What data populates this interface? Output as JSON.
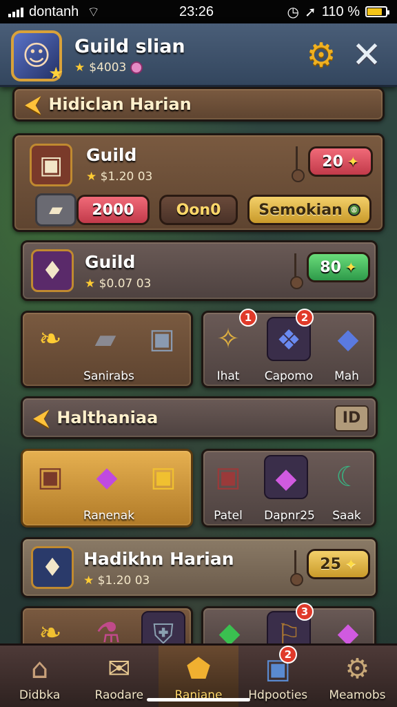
{
  "status_bar": {
    "carrier": "dontanh",
    "time": "23:26",
    "battery": "110 %"
  },
  "header": {
    "title": "Guild slian",
    "currency": "$4003",
    "icons": [
      "avatar",
      "gear-icon",
      "close-icon"
    ]
  },
  "section1": {
    "title": "Hidiclan Harian"
  },
  "guild_card1": {
    "title": "Guild",
    "sub": "$1.20 03",
    "reward": "20",
    "buttons": [
      "2000",
      "Oon0",
      "Semokian"
    ]
  },
  "guild_card2": {
    "title": "Guild",
    "sub": "$0.07 03",
    "reward": "80"
  },
  "row1_left": {
    "label": "Sanirabs"
  },
  "row1_right": {
    "labels": [
      "Ihat",
      "Capomo",
      "Mah"
    ],
    "badges": [
      "1",
      "2"
    ]
  },
  "section2": {
    "title": "Halthaniaa",
    "tag": "ID"
  },
  "row2_left": {
    "label": "Ranenak"
  },
  "row2_right": {
    "labels": [
      "Patel",
      "Dapnr25",
      "Saak"
    ]
  },
  "guild_card3": {
    "title": "Hadikhn Harian",
    "sub": "$1.20 03",
    "reward": "25"
  },
  "row3_right": {
    "badges": [
      "3"
    ]
  },
  "nav": {
    "items": [
      {
        "label": "Didbka",
        "icon": "home-icon"
      },
      {
        "label": "Raodare",
        "icon": "scroll-icon"
      },
      {
        "label": "Raniane",
        "icon": "hero-icon"
      },
      {
        "label": "Hdpooties",
        "icon": "box-icon",
        "badge": "2"
      },
      {
        "label": "Meamobs",
        "icon": "settings-icon"
      }
    ]
  },
  "colors": {
    "accent": "#ffc23a",
    "red": "#e03a2a",
    "green": "#2e9a4a"
  }
}
